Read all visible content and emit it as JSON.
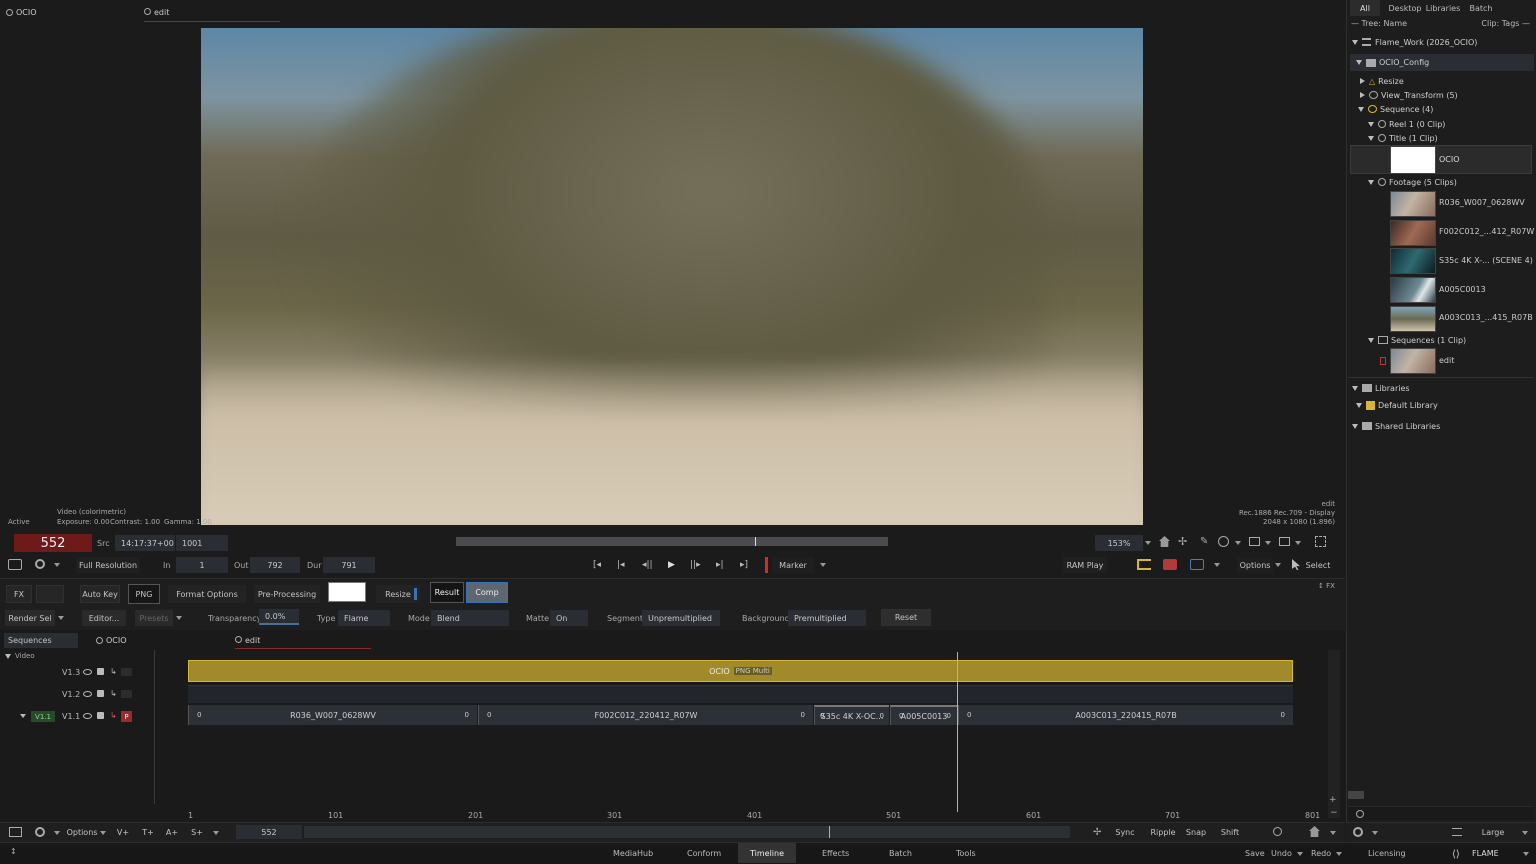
{
  "viewer": {
    "left_tab_icon": "gear-icon",
    "left_tab": "OCIO",
    "right_tab": "edit",
    "status_active": "Active",
    "info_video": "Video (colorimetric)",
    "info_exposure": "Exposure: 0.00",
    "info_contrast": "Contrast: 1.00",
    "info_gamma": "Gamma: 1.00",
    "info_right_name": "edit",
    "info_right_display": "Rec.1886 Rec.709 - Display",
    "info_right_res": "2048 x 1080 (1.896)"
  },
  "transport": {
    "frame": "552",
    "src_label": "Src",
    "timecode": "14:17:37+00",
    "src_frame": "1001",
    "zoom": "153%",
    "resolution": "Full Resolution",
    "in_label": "In",
    "in_value": "1",
    "out_label": "Out",
    "out_value": "792",
    "dur_label": "Dur",
    "dur_value": "791",
    "marker": "Marker",
    "ram_play": "RAM Play",
    "options": "Options",
    "select": "Select"
  },
  "fx_bar": {
    "fx": "FX",
    "auto_key": "Auto Key",
    "png": "PNG",
    "format_options": "Format Options",
    "pre_processing": "Pre-Processing",
    "resize": "Resize",
    "result": "Result",
    "comp": "Comp",
    "fx_toggle": "↕ FX"
  },
  "params": {
    "render_sel": "Render Sel",
    "editor": "Editor...",
    "presets": "Presets",
    "transparency_label": "Transparency",
    "transparency_value": "0.0%",
    "type_label": "Type",
    "type_value": "Flame",
    "mode_label": "Mode",
    "mode_value": "Blend",
    "matte_label": "Matte",
    "matte_value": "On",
    "segment_label": "Segment",
    "segment_value": "Unpremultiplied",
    "background_label": "Background",
    "background_value": "Premultiplied",
    "reset": "Reset"
  },
  "timeline": {
    "sequences_tab": "Sequences",
    "ocio_tab": "OCIO",
    "edit_tab": "edit",
    "video_label": "Video",
    "tracks": [
      {
        "name": "V1.3"
      },
      {
        "name": "V1.2"
      },
      {
        "name": "V1.1",
        "patch": "V1.1",
        "p": "P"
      }
    ],
    "title_clip": "OCIO",
    "title_badge": "PNG Multi",
    "clips": [
      {
        "name": "R036_W007_0628WV",
        "in": "0",
        "out": "0"
      },
      {
        "name": "F002C012_220412_R07W",
        "in": "0",
        "out": "0"
      },
      {
        "name": "S35c 4K X-OC...",
        "in": "0",
        "out": "0"
      },
      {
        "name": "A005C0013",
        "in": "0",
        "out": "0"
      },
      {
        "name": "A003C013_220415_R07B",
        "in": "0",
        "out": "0"
      }
    ],
    "ruler": [
      "1",
      "101",
      "201",
      "301",
      "401",
      "501",
      "601",
      "701",
      "801"
    ],
    "footer_options": "Options",
    "footer_v": "V+",
    "footer_t": "T+",
    "footer_a": "A+",
    "footer_s": "S+",
    "footer_frame": "552",
    "sync": "Sync",
    "ripple": "Ripple",
    "snap": "Snap",
    "shift": "Shift"
  },
  "browser": {
    "tabs": [
      "All",
      "Desktop",
      "Libraries",
      "Batch"
    ],
    "tree_name": "— Tree: Name",
    "clip_tags": "Clip: Tags —",
    "workspace": "Flame_Work (2026_OCIO)",
    "project": "OCIO_Config",
    "resize": "Resize",
    "view_transform": "View_Transform (5)",
    "sequence": "Sequence (4)",
    "reel1": "Reel 1 (0 Clip)",
    "title": "Title (1 Clip)",
    "title_clip": "OCIO",
    "footage": "Footage (5 Clips)",
    "footage_clips": [
      "R036_W007_0628WV",
      "F002C012_...412_R07W",
      "S35c 4K X-... (SCENE 4)",
      "A005C0013",
      "A003C013_...415_R07B"
    ],
    "sequences": "Sequences (1 Clip)",
    "seq_clip": "edit",
    "libraries": "Libraries",
    "default_library": "Default Library",
    "shared_libraries": "Shared Libraries",
    "size": "Large"
  },
  "bottom_nav": {
    "items": [
      "MediaHub",
      "Conform",
      "Timeline",
      "Effects",
      "Batch",
      "Tools"
    ],
    "active": "Timeline",
    "save": "Save",
    "undo": "Undo",
    "redo": "Redo",
    "licensing": "Licensing",
    "brand": "FLAME"
  },
  "colors": {
    "accent": "#d9b535",
    "title_track": "#a08a2a",
    "frame_bg": "#6e1a1a",
    "active_tab": "#3a3a3a"
  }
}
